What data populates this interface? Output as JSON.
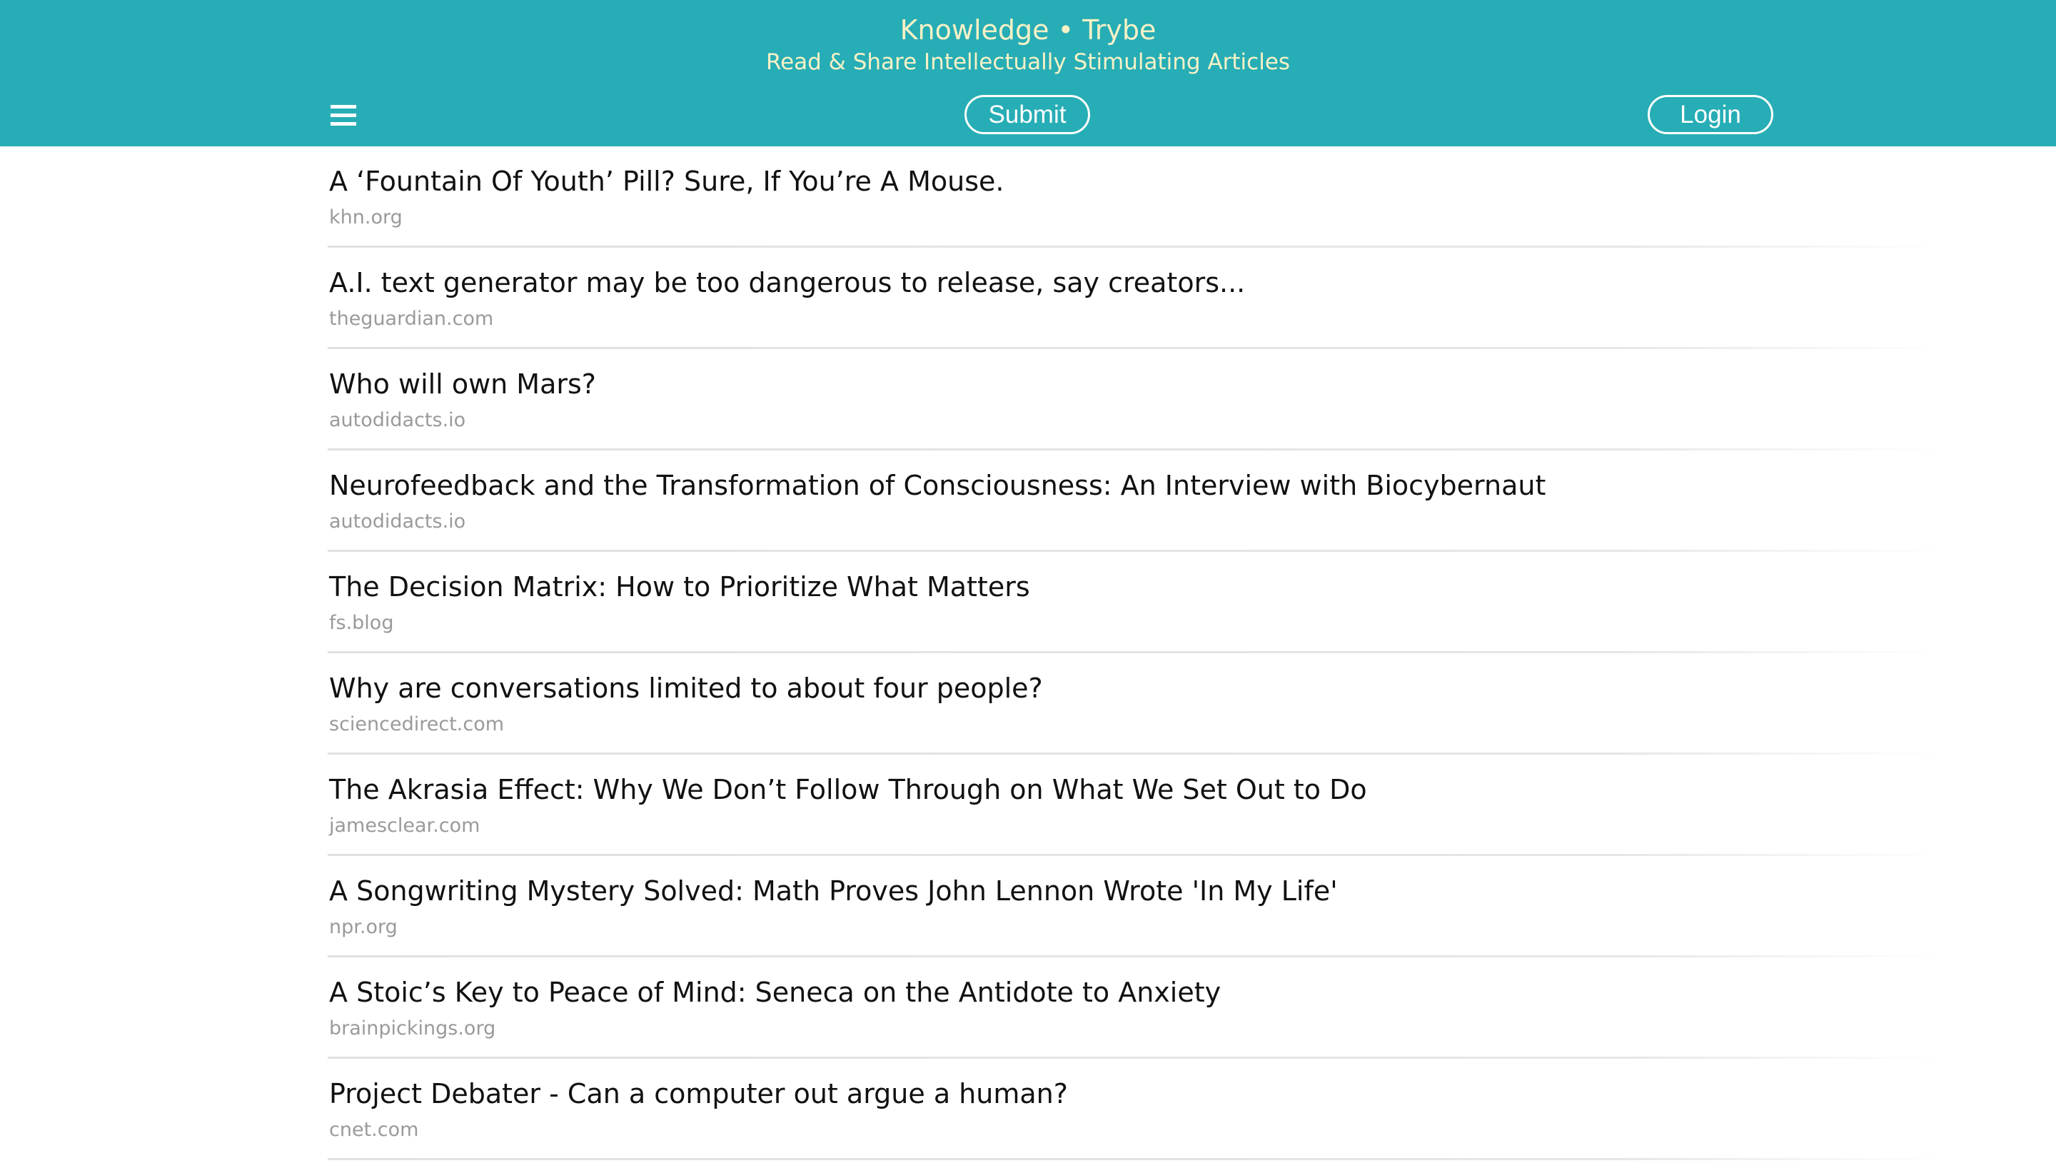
{
  "header": {
    "title": "Knowledge • Trybe",
    "subtitle": "Read & Share Intellectually Stimulating Articles",
    "menu_icon": "hamburger-menu-icon",
    "submit_label": "Submit",
    "login_label": "Login",
    "background_color": "#27adb5",
    "title_color": "#f6f1c6"
  },
  "articles": [
    {
      "title": "A ‘Fountain Of Youth’ Pill? Sure, If You’re A Mouse.",
      "domain": "khn.org"
    },
    {
      "title": "A.I. text generator may be too dangerous to release, say creators...",
      "domain": "theguardian.com"
    },
    {
      "title": "Who will own Mars?",
      "domain": "autodidacts.io"
    },
    {
      "title": "Neurofeedback and the Transformation of Consciousness: An Interview with Biocybernaut",
      "domain": "autodidacts.io"
    },
    {
      "title": "The Decision Matrix: How to Prioritize What Matters",
      "domain": "fs.blog"
    },
    {
      "title": "Why are conversations limited to about four people?",
      "domain": "sciencedirect.com"
    },
    {
      "title": "The Akrasia Effect: Why We Don’t Follow Through on What We Set Out to Do",
      "domain": "jamesclear.com"
    },
    {
      "title": "A Songwriting Mystery Solved: Math Proves John Lennon Wrote 'In My Life'",
      "domain": "npr.org"
    },
    {
      "title": "A Stoic’s Key to Peace of Mind: Seneca on the Antidote to Anxiety",
      "domain": "brainpickings.org"
    },
    {
      "title": "Project Debater - Can a computer out argue a human?",
      "domain": "cnet.com"
    }
  ]
}
